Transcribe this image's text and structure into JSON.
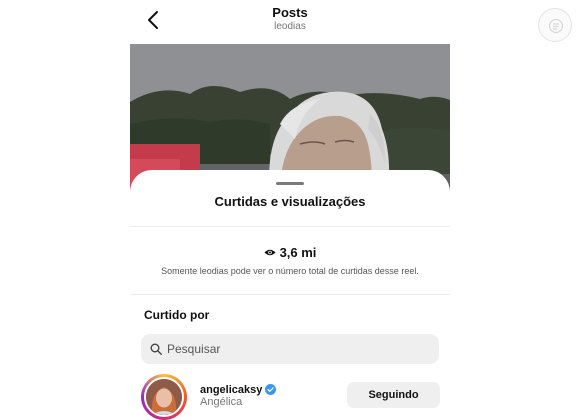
{
  "header": {
    "title": "Posts",
    "username": "leodias",
    "back_icon": "chevron-left-icon"
  },
  "sheet": {
    "title": "Curtidas e visualizações",
    "views_icon": "eye-icon",
    "views_count": "3,6 mi",
    "views_note": "Somente leodias pode ver o número total de curtidas desse reel.",
    "liked_by_heading": "Curtido por"
  },
  "search": {
    "placeholder": "Pesquisar",
    "icon": "search-icon"
  },
  "likers": [
    {
      "username": "angelicaksy",
      "full_name": "Angélica",
      "verified": true,
      "button_label": "Seguindo"
    }
  ],
  "colors": {
    "accent_blue": "#3897f0",
    "button_bg": "#efefef",
    "search_bg": "#efefef"
  }
}
